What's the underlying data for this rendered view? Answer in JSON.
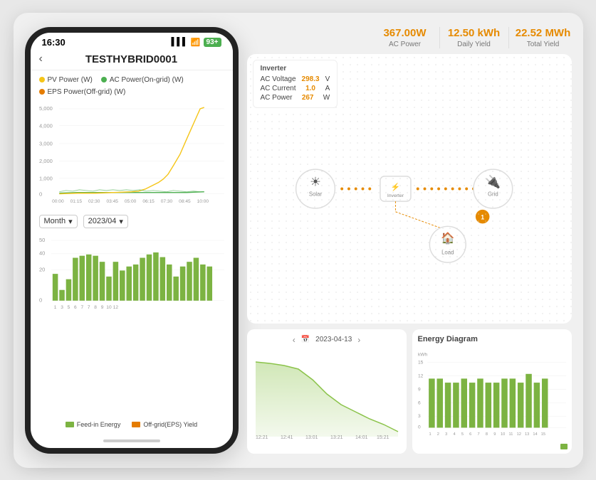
{
  "phone": {
    "status_time": "16:30",
    "battery_level": "93+",
    "title": "TESTHYBRID0001",
    "legend": [
      {
        "label": "PV Power (W)",
        "color": "#f5c518"
      },
      {
        "label": "AC Power(On-grid) (W)",
        "color": "#4caf50"
      },
      {
        "label": "EPS Power(Off-grid) (W)",
        "color": "#e57c00"
      }
    ],
    "line_chart": {
      "y_labels": [
        "5,000",
        "4,000",
        "3,000",
        "2,000",
        "1,000",
        "0"
      ],
      "x_labels": [
        "00:00",
        "01:15",
        "02:30",
        "03:45",
        "05:00",
        "06:15",
        "07:30",
        "08:45",
        "10:00"
      ]
    },
    "bar_controls": {
      "period_label": "Month",
      "date_label": "2023/04"
    },
    "bar_chart": {
      "y_max": 50,
      "y_labels": [
        "50",
        "40",
        "",
        "20",
        "",
        "0"
      ],
      "x_labels": [
        "1",
        "3",
        "5",
        "6",
        "7",
        "7",
        "8",
        "9",
        "10",
        "12"
      ],
      "bars": [
        22,
        8,
        18,
        35,
        37,
        38,
        37,
        32,
        20,
        32,
        25,
        28,
        30,
        35,
        38,
        40,
        36,
        30,
        22,
        28,
        32,
        35,
        30,
        28
      ]
    },
    "bar_legend": [
      {
        "label": "Feed-in Energy",
        "color": "#7cb342"
      },
      {
        "label": "Off-grid(EPS) Yield",
        "color": "#e57c00"
      }
    ]
  },
  "stats": [
    {
      "value": "367.00W",
      "label": "AC Power"
    },
    {
      "value": "12.50 kWh",
      "label": "Daily Yield"
    },
    {
      "value": "22.52 MWh",
      "label": "Total Yield"
    }
  ],
  "inverter": {
    "title": "Inverter",
    "rows": [
      {
        "label": "AC Voltage",
        "value": "298.3",
        "unit": "V"
      },
      {
        "label": "AC Current",
        "value": "1.0",
        "unit": "A"
      },
      {
        "label": "AC Power",
        "value": "267",
        "unit": "W"
      }
    ]
  },
  "bottom": {
    "date_card": {
      "date": "2023-04-13"
    },
    "energy_diagram": {
      "title": "Energy Diagram",
      "y_label": "kWh",
      "y_max": 15,
      "y_labels": [
        "15",
        "12",
        "9",
        "6",
        "3",
        "0"
      ],
      "x_labels": [
        "1",
        "2",
        "3",
        "4",
        "5",
        "6",
        "7",
        "8",
        "9",
        "10",
        "11",
        "12",
        "13",
        "14",
        "15"
      ],
      "bars": [
        11,
        11,
        10,
        10,
        11,
        10,
        11,
        10,
        10,
        11,
        11,
        10,
        12,
        10,
        11
      ]
    }
  }
}
